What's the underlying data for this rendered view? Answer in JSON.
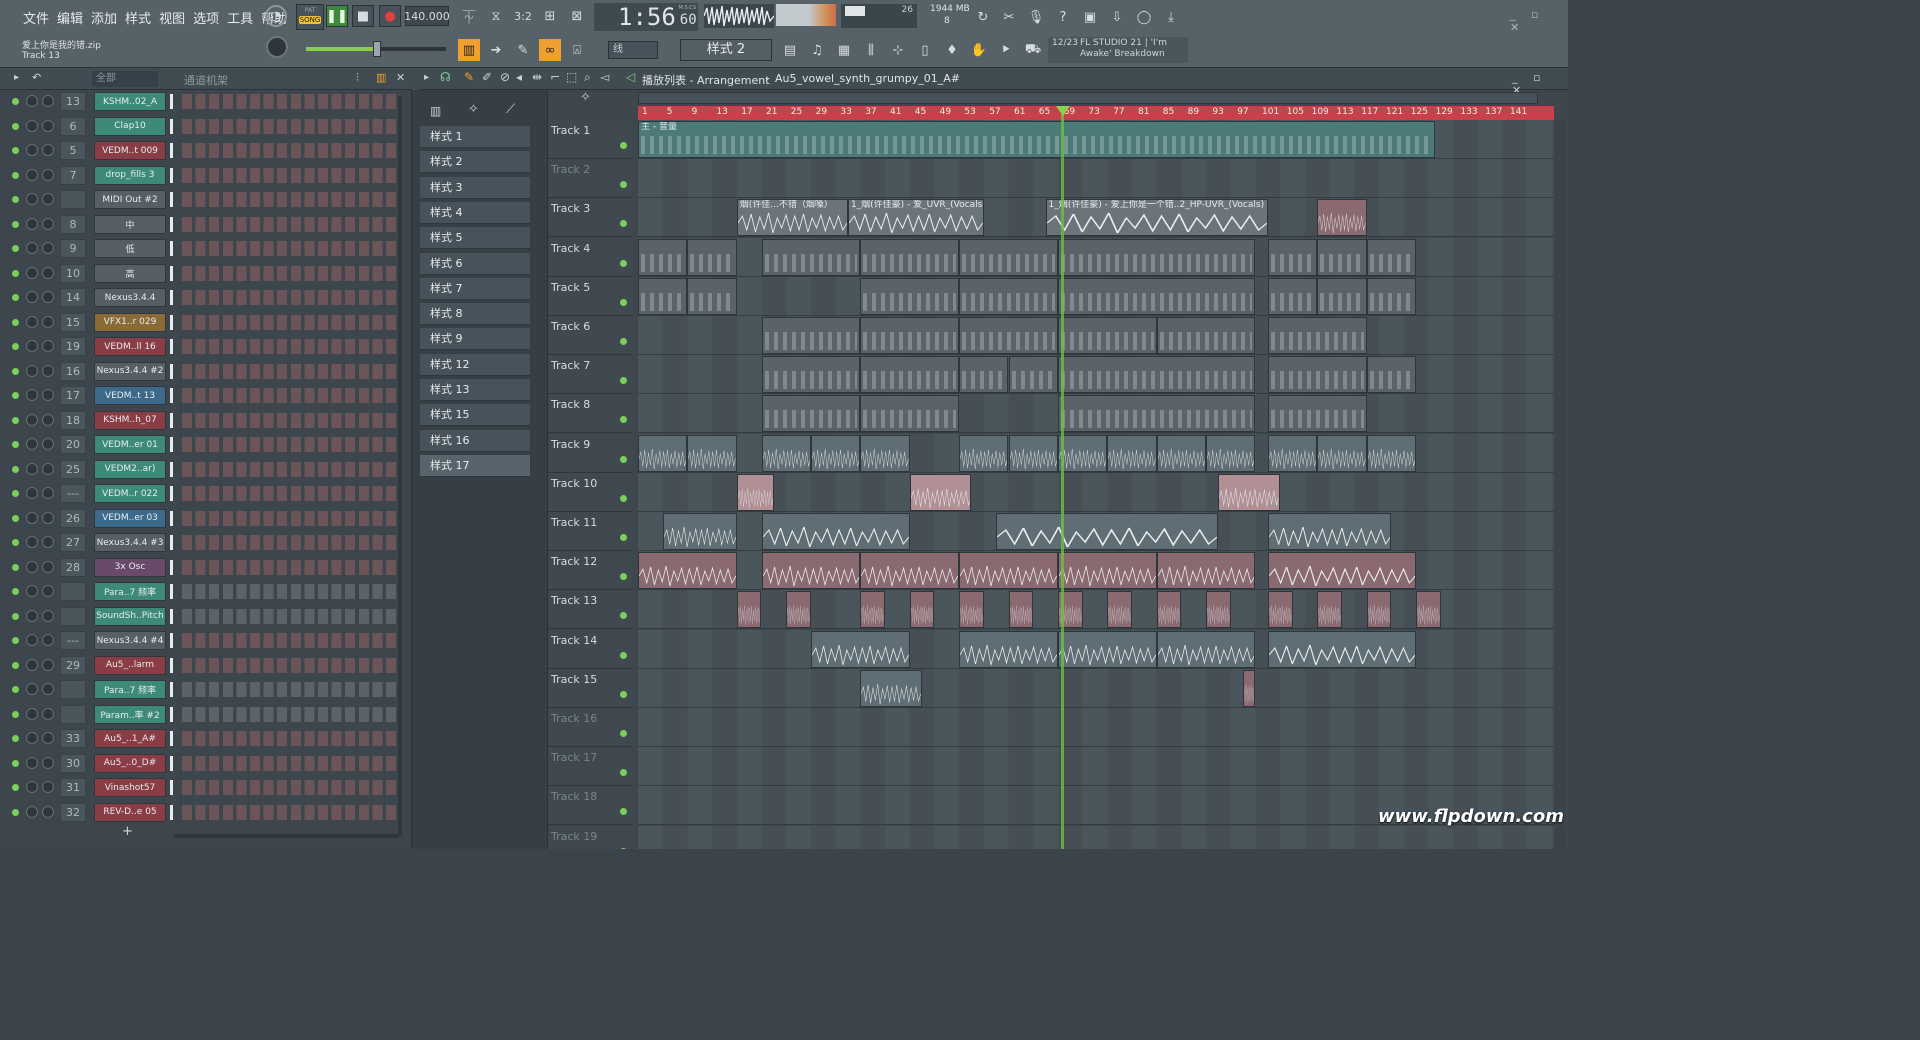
{
  "menu": [
    "文件",
    "编辑",
    "添加",
    "样式",
    "视图",
    "选项",
    "工具",
    "帮助"
  ],
  "transport": {
    "mode_pat": "PAT",
    "mode_song": "SONG",
    "tempo": "140.000",
    "time": "1:56",
    "time_small": "60",
    "time_unit": "M:S:CS",
    "cpu": "26",
    "memory": "1944 MB",
    "voices": "8"
  },
  "project": {
    "file": "爱上你是我的错.zip",
    "track": "Track 13"
  },
  "toolbar2": {
    "snap": "线",
    "pattern_selector": "样式 2",
    "news_date": "12/23",
    "news_text": "FL STUDIO 21 | 'I'm Awake' Breakdown"
  },
  "rack": {
    "filter": "全部",
    "title": "通道机架",
    "add_label": "+"
  },
  "channels": [
    {
      "num": "13",
      "name": "KSHM..02_A",
      "color": "#3d8a7a",
      "steps": "red"
    },
    {
      "num": "6",
      "name": "Clap10",
      "color": "#3d8a7a",
      "steps": "red"
    },
    {
      "num": "5",
      "name": "VEDM..t 009",
      "color": "#8a3d45",
      "steps": "red"
    },
    {
      "num": "7",
      "name": "drop_fills 3",
      "color": "#3d8a7a",
      "steps": "red"
    },
    {
      "num": "",
      "name": "MIDI Out #2",
      "color": "#555f65",
      "steps": "red"
    },
    {
      "num": "8",
      "name": "中",
      "color": "#555f65",
      "steps": "red"
    },
    {
      "num": "9",
      "name": "低",
      "color": "#555f65",
      "steps": "red"
    },
    {
      "num": "10",
      "name": "高",
      "color": "#555f65",
      "steps": "red"
    },
    {
      "num": "14",
      "name": "Nexus3.4.4",
      "color": "#555f65",
      "steps": "red"
    },
    {
      "num": "15",
      "name": "VFX1..r 029",
      "color": "#8a6a35",
      "steps": "red"
    },
    {
      "num": "19",
      "name": "VEDM..ll 16",
      "color": "#8a3d45",
      "steps": "red"
    },
    {
      "num": "16",
      "name": "Nexus3.4.4 #2",
      "color": "#555f65",
      "steps": "red"
    },
    {
      "num": "17",
      "name": "VEDM..t 13",
      "color": "#3d6a8a",
      "steps": "red"
    },
    {
      "num": "18",
      "name": "KSHM..h_07",
      "color": "#8a3d45",
      "steps": "red"
    },
    {
      "num": "20",
      "name": "VEDM..er 01",
      "color": "#3d8a7a",
      "steps": "red"
    },
    {
      "num": "25",
      "name": "VEDM2..ar)",
      "color": "#3d8a7a",
      "steps": "red"
    },
    {
      "num": "---",
      "name": "VEDM..r 022",
      "color": "#3d8a7a",
      "steps": "red"
    },
    {
      "num": "26",
      "name": "VEDM..er 03",
      "color": "#3d6a8a",
      "steps": "red"
    },
    {
      "num": "27",
      "name": "Nexus3.4.4 #3",
      "color": "#555f65",
      "steps": "red"
    },
    {
      "num": "28",
      "name": "3x Osc",
      "color": "#6a4a6a",
      "steps": "red"
    },
    {
      "num": "",
      "name": "Para..7 频率",
      "color": "#3d8a7a",
      "steps": "grey"
    },
    {
      "num": "",
      "name": "SoundSh..Pitch",
      "color": "#3d8a7a",
      "steps": "grey"
    },
    {
      "num": "---",
      "name": "Nexus3.4.4 #4",
      "color": "#555f65",
      "steps": "red"
    },
    {
      "num": "29",
      "name": "Au5_..larm",
      "color": "#8a3d45",
      "steps": "red"
    },
    {
      "num": "",
      "name": "Para..7 频率",
      "color": "#3d8a7a",
      "steps": "grey"
    },
    {
      "num": "",
      "name": "Param..率 #2",
      "color": "#3d8a7a",
      "steps": "grey"
    },
    {
      "num": "33",
      "name": "Au5_..1_A#",
      "color": "#8a3d45",
      "steps": "red"
    },
    {
      "num": "30",
      "name": "Au5_..0_D#",
      "color": "#8a3d45",
      "steps": "red"
    },
    {
      "num": "31",
      "name": "Vinashot57",
      "color": "#8a3d45",
      "steps": "red"
    },
    {
      "num": "32",
      "name": "REV-D..e 05",
      "color": "#8a3d45",
      "steps": "red"
    }
  ],
  "patterns": [
    "样式 1",
    "样式 2",
    "样式 3",
    "样式 4",
    "样式 5",
    "样式 6",
    "样式 7",
    "样式 8",
    "样式 9",
    "样式 12",
    "样式 13",
    "样式 15",
    "样式 16",
    "样式 17"
  ],
  "playlist": {
    "title": "播放列表 - Arrangement",
    "breadcrumb_sep": "›",
    "current": "Au5_vowel_synth_grumpy_01_A#",
    "ruler": [
      "1",
      "5",
      "9",
      "13",
      "17",
      "21",
      "25",
      "29",
      "33",
      "37",
      "41",
      "45",
      "49",
      "53",
      "57",
      "61",
      "65",
      "69",
      "73",
      "77",
      "81",
      "85",
      "89",
      "93",
      "97",
      "101",
      "105",
      "109",
      "113",
      "117",
      "121",
      "125",
      "129",
      "133",
      "137",
      "141"
    ],
    "tracks": [
      "Track 1",
      "Track 2",
      "Track 3",
      "Track 4",
      "Track 5",
      "Track 6",
      "Track 7",
      "Track 8",
      "Track 9",
      "Track 10",
      "Track 11",
      "Track 12",
      "Track 13",
      "Track 14",
      "Track 15",
      "Track 16",
      "Track 17",
      "Track 18",
      "Track 19"
    ],
    "master_clip": "主 - 音量",
    "vocal_clips": [
      "烟(许佳...不错（烟嗓）",
      "1_烟(许佳豪) - 爱_UVR_(Vocals)",
      "1_烟(许佳豪) - 爱上你是一个错..2_HP-UVR_(Vocals)"
    ]
  },
  "watermark": "www.flpdown.com",
  "colors": {
    "accent_orange": "#f0a030",
    "playhead": "#6ac040",
    "ruler_red": "#c8404c"
  }
}
